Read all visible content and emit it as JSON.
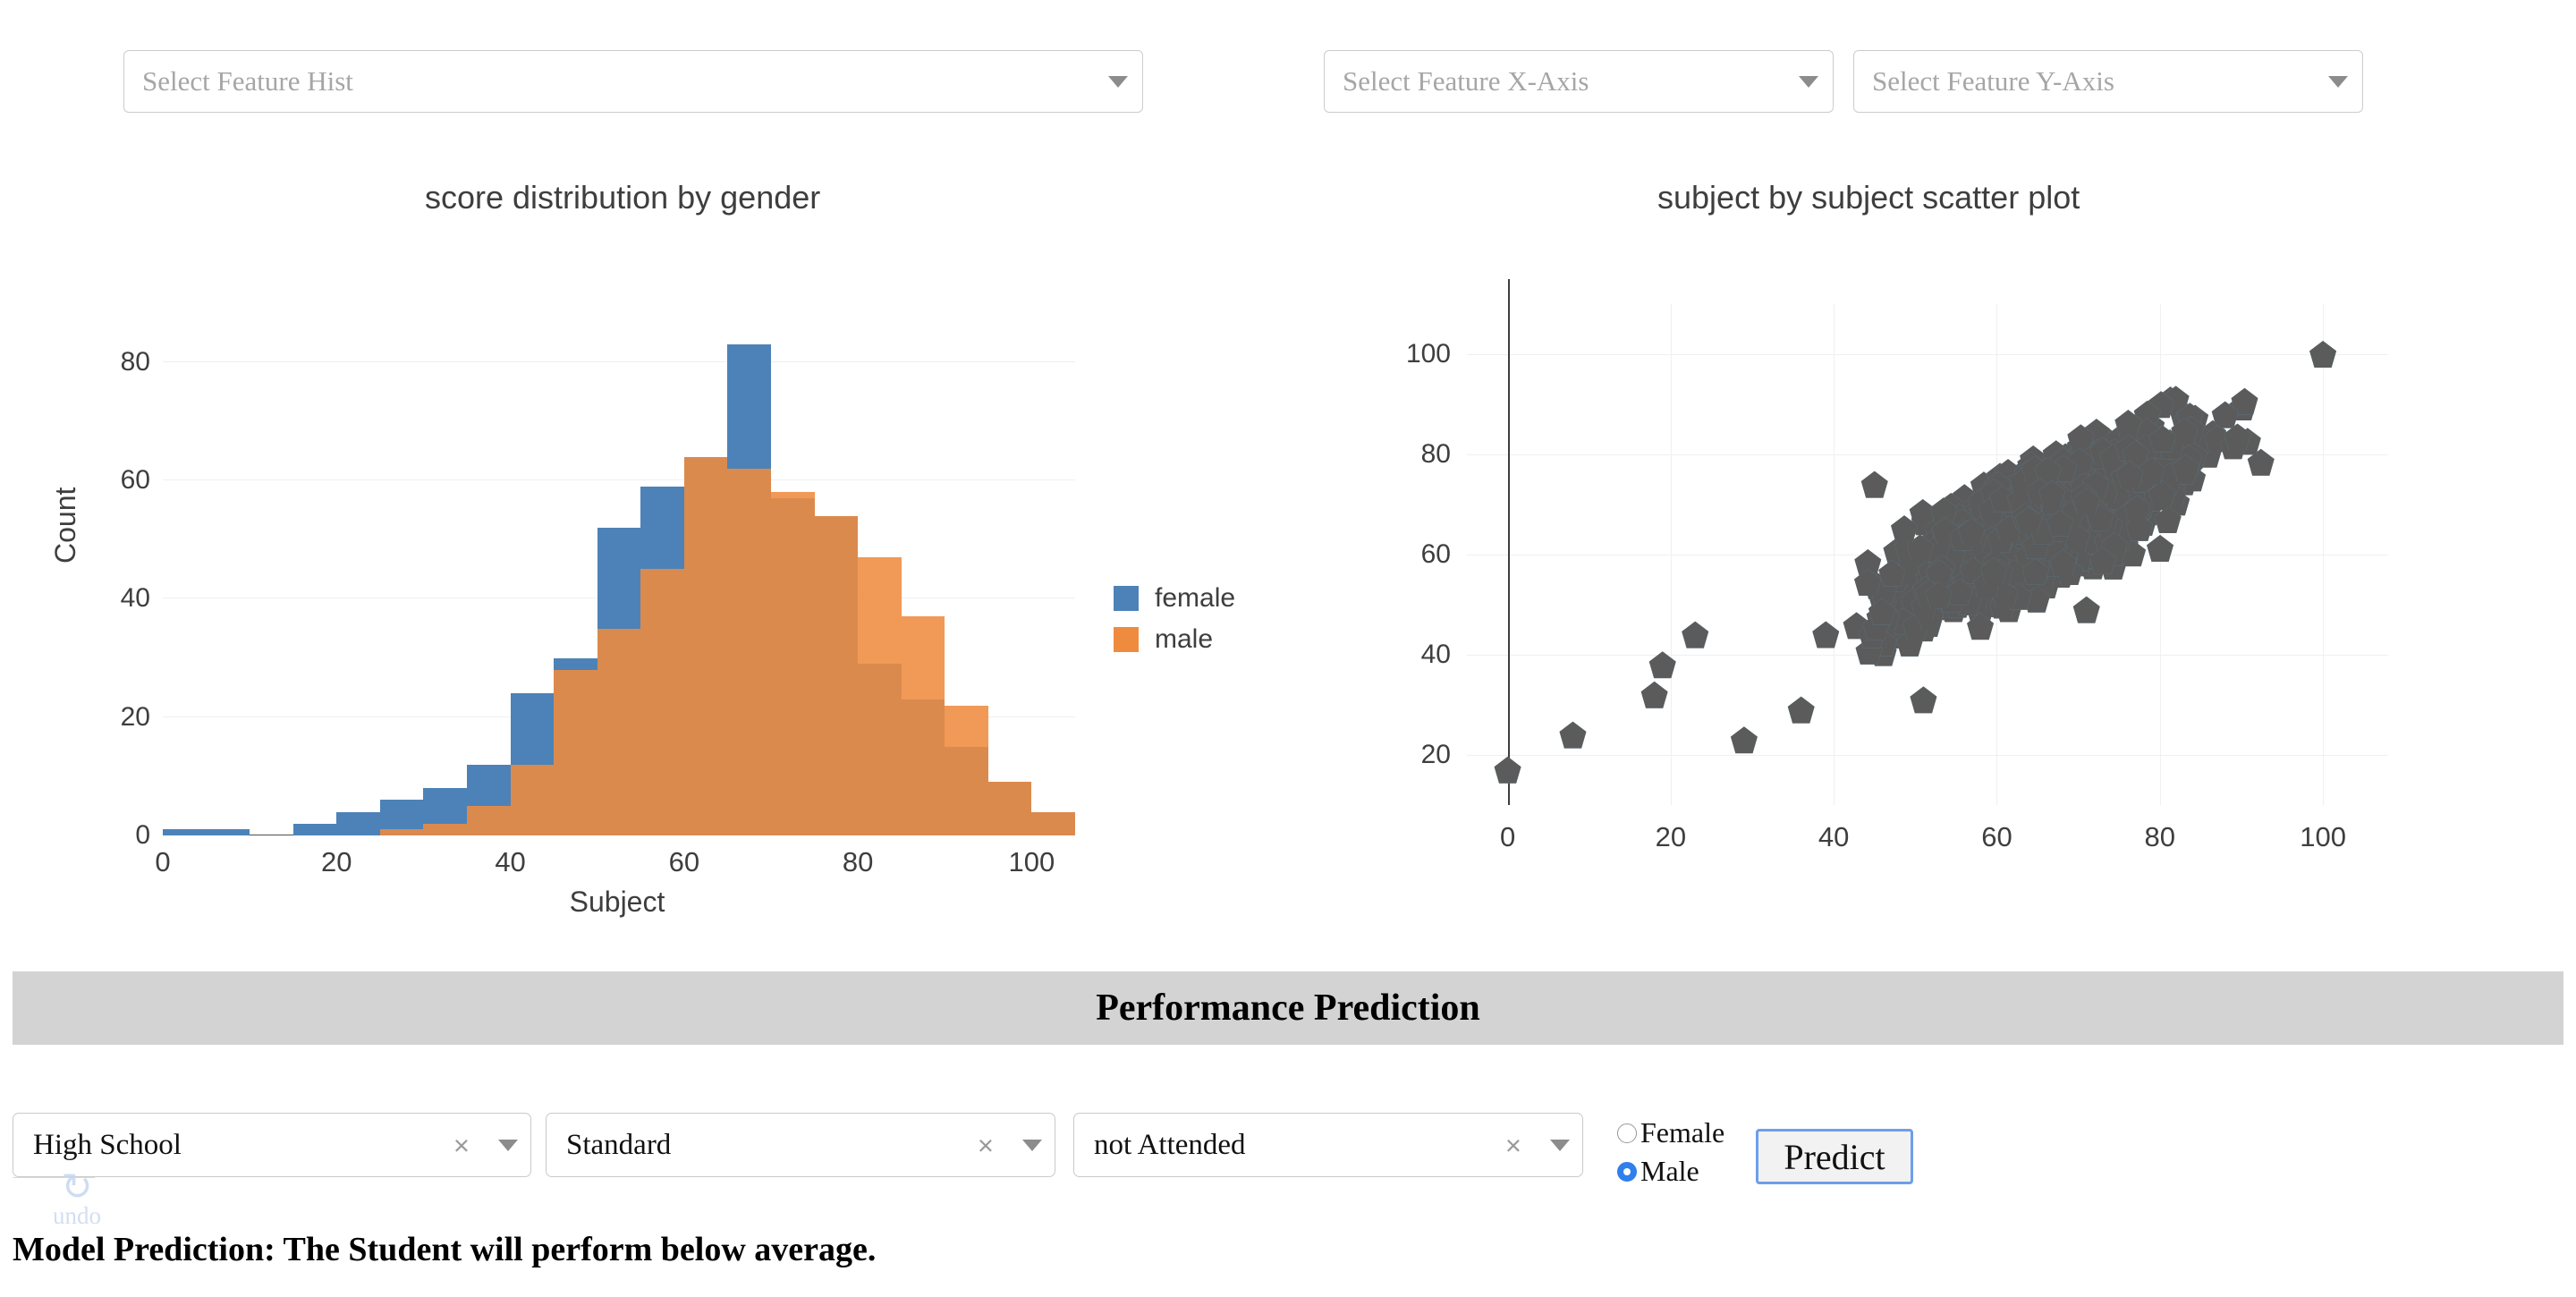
{
  "top_controls": {
    "feature_hist": {
      "placeholder": "Select Feature Hist",
      "value": "",
      "caret_icon": "chevron-down-icon"
    },
    "feature_x": {
      "placeholder": "Select Feature X-Axis",
      "value": "",
      "caret_icon": "chevron-down-icon"
    },
    "feature_y": {
      "placeholder": "Select Feature Y-Axis",
      "value": "",
      "caret_icon": "chevron-down-icon"
    }
  },
  "performance_section": {
    "title": "Performance Prediction",
    "education": {
      "value": "High School",
      "clear_icon": "×",
      "caret_icon": "chevron-down-icon"
    },
    "lunch": {
      "value": "Standard",
      "clear_icon": "×",
      "caret_icon": "chevron-down-icon"
    },
    "prep_course": {
      "value": "not Attended",
      "clear_icon": "×",
      "caret_icon": "chevron-down-icon"
    },
    "gender": {
      "options": [
        "Female",
        "Male"
      ],
      "selected": "Male"
    },
    "predict_button": "Predict",
    "undo": {
      "label": "undo",
      "icon": "undo-icon"
    },
    "prediction_text": "Model Prediction: The Student will perform below average."
  },
  "colors": {
    "female": "#4c82b8",
    "male": "#ef8b3f",
    "scatter_marker": "#57c0f5",
    "scatter_marker_edge": "#5b5b5b",
    "section_bar": "#d3d3d3",
    "predict_border": "#6d9eeb",
    "radio_selected": "#2f7fec"
  },
  "chart_data": [
    {
      "type": "bar",
      "chart_name": "histogram",
      "title": "score distribution by gender",
      "xlabel": "Subject",
      "ylabel": "Count",
      "xlim": [
        0,
        105
      ],
      "ylim": [
        0,
        88
      ],
      "xticks": [
        0,
        20,
        40,
        60,
        80,
        100
      ],
      "yticks": [
        0,
        20,
        40,
        60,
        80
      ],
      "grid": true,
      "overlay": "overlaid",
      "legend": {
        "position": "right",
        "entries": [
          "female",
          "male"
        ]
      },
      "bin_edges": [
        0,
        5,
        10,
        15,
        20,
        25,
        30,
        35,
        40,
        45,
        50,
        55,
        60,
        65,
        70,
        75,
        80,
        85,
        90,
        95,
        100,
        105
      ],
      "series": [
        {
          "name": "female",
          "color": "#4c82b8",
          "values": [
            1,
            1,
            0,
            2,
            4,
            6,
            8,
            12,
            24,
            30,
            52,
            59,
            64,
            83,
            57,
            54,
            29,
            23,
            15,
            9,
            4
          ]
        },
        {
          "name": "male",
          "color": "#ef8b3f",
          "values": [
            0,
            0,
            0,
            0,
            0,
            1,
            2,
            5,
            12,
            28,
            35,
            45,
            64,
            62,
            58,
            54,
            47,
            37,
            22,
            9,
            4
          ]
        }
      ]
    },
    {
      "type": "scatter",
      "chart_name": "scatter",
      "title": "subject by subject scatter plot",
      "xlabel": "",
      "ylabel": "",
      "xlim": [
        -5,
        108
      ],
      "ylim": [
        10,
        110
      ],
      "xticks": [
        0,
        20,
        40,
        60,
        80,
        100
      ],
      "yticks": [
        20,
        40,
        60,
        80,
        100
      ],
      "grid": true,
      "marker": "pentagon",
      "marker_color": "#57c0f5",
      "marker_edge_color": "#5b5b5b",
      "n_points": 1000,
      "correlation": "strong positive, linear",
      "notable_points": [
        {
          "x": 0,
          "y": 17
        },
        {
          "x": 8,
          "y": 24
        },
        {
          "x": 19,
          "y": 38
        },
        {
          "x": 18,
          "y": 32
        },
        {
          "x": 23,
          "y": 44
        },
        {
          "x": 29,
          "y": 23
        },
        {
          "x": 36,
          "y": 29
        },
        {
          "x": 45,
          "y": 74
        },
        {
          "x": 51,
          "y": 31
        },
        {
          "x": 71,
          "y": 49
        },
        {
          "x": 100,
          "y": 100
        }
      ]
    }
  ]
}
